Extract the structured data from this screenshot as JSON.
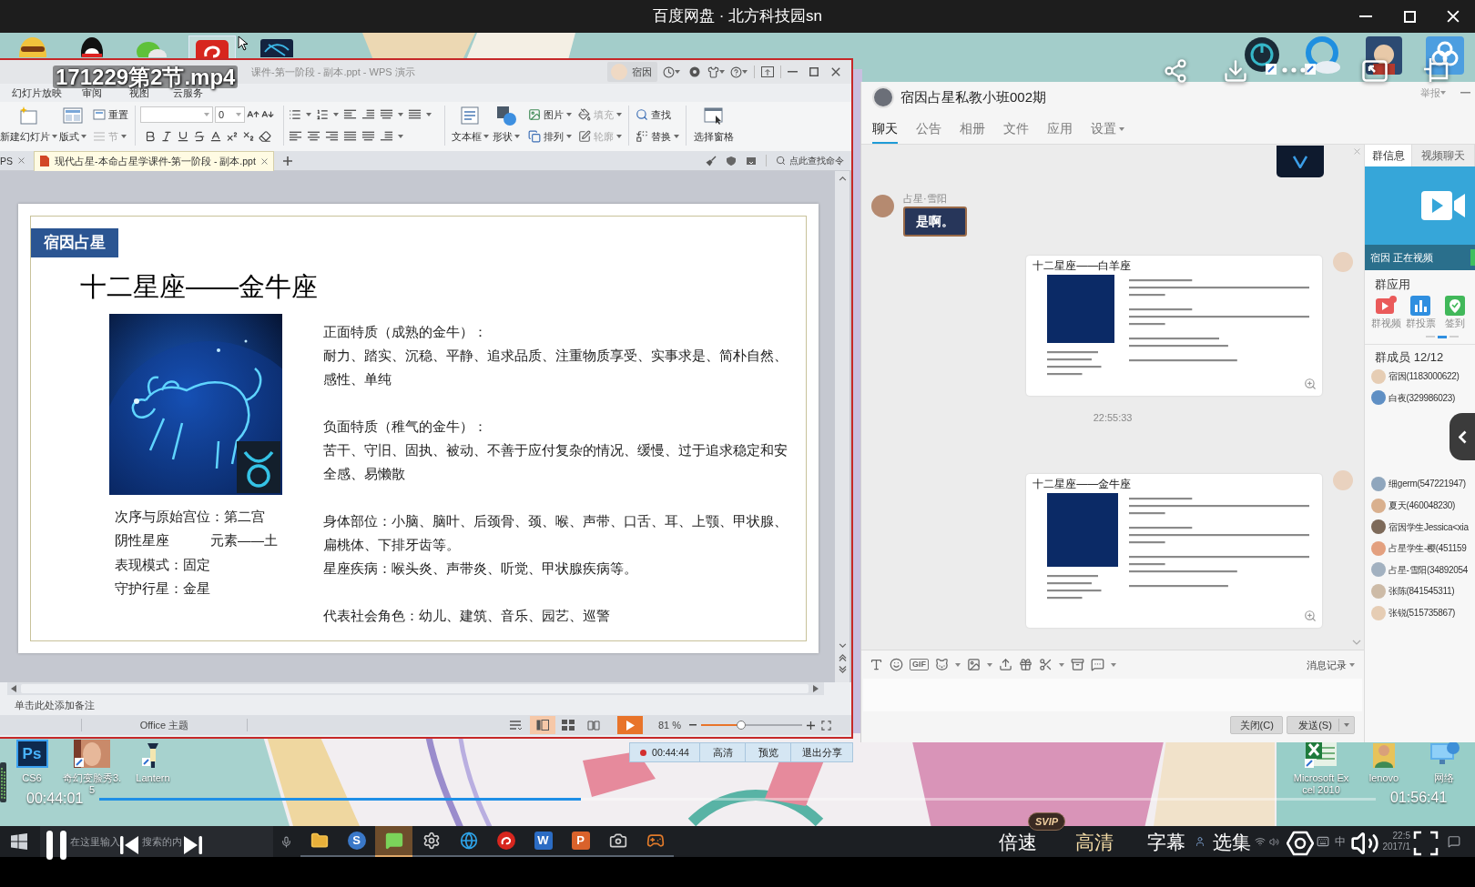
{
  "player": {
    "title": "百度网盘 · 北方科技园sn",
    "file_name": "171229第2节.mp4",
    "playing": true,
    "elapsed": "00:44:01",
    "duration": "01:56:41",
    "level": 0.377,
    "controls": [
      {
        "kind": "speed",
        "label": "倍速",
        "badge": "SVIP",
        "highlighted": false
      },
      {
        "kind": "quality",
        "label": "高清",
        "highlighted": true
      },
      {
        "kind": "subtitles",
        "label": "字幕",
        "highlighted": false
      },
      {
        "kind": "episodes",
        "label": "选集",
        "highlighted": false
      }
    ]
  },
  "desktop": {
    "top_left_icons": [
      {
        "kind": "mask",
        "selected": false
      },
      {
        "kind": "penguin",
        "selected": false
      },
      {
        "kind": "chat",
        "selected": false
      },
      {
        "kind": "music",
        "selected": true
      },
      {
        "kind": "star",
        "selected": false
      }
    ],
    "top_right_icons": [
      {
        "kind": "power"
      },
      {
        "kind": "cloud"
      },
      {
        "kind": "cartoon"
      },
      {
        "kind": "cloud-logo"
      }
    ],
    "bottom_left_icons": [
      {
        "kind": "photoshop",
        "glyph": "Ps",
        "label": "CS6"
      },
      {
        "kind": "photo-app",
        "label": "奇幻变脸秀3.5"
      },
      {
        "kind": "lantern",
        "label": "Lantern"
      }
    ],
    "bottom_right_icons": [
      {
        "kind": "excel",
        "label": "Microsoft Excel 2010"
      },
      {
        "kind": "user",
        "label": "lenovo"
      },
      {
        "kind": "network",
        "label": "网络"
      }
    ]
  },
  "wps": {
    "title": "课件-第一阶段 - 副本.ppt - WPS 演示",
    "user": "宿因",
    "menu": [
      "幻灯片放映",
      "审阅",
      "视图",
      "云服务"
    ],
    "ribbon": {
      "new_slide": {
        "label": "新建幻灯片",
        "disabled": false
      },
      "layout": {
        "label": "版式",
        "disabled": false
      },
      "reset": {
        "label": "重置",
        "disabled": false
      },
      "section": {
        "label": "节",
        "disabled": true
      },
      "font_size": "0",
      "text_box": {
        "label": "文本框",
        "disabled": false
      },
      "shape": {
        "label": "形状",
        "disabled": false
      },
      "picture": {
        "label": "图片",
        "disabled": false
      },
      "fill": {
        "label": "填充",
        "disabled": true
      },
      "arrange": {
        "label": "排列",
        "disabled": false
      },
      "outline": {
        "label": "轮廓",
        "disabled": true
      },
      "find": {
        "label": "查找",
        "disabled": false
      },
      "replace": {
        "label": "替换",
        "disabled": false
      },
      "selection_pane": {
        "label": "选择窗格",
        "disabled": false
      }
    },
    "tabs": [
      {
        "label": "PS",
        "selected": false
      },
      {
        "label": "现代占星-本命占星学课件-第一阶段 - 副本.ppt",
        "selected": true
      }
    ],
    "command_search": "点此查找命令",
    "slide": {
      "tag": "宿因占星",
      "title": "十二星座——金牛座",
      "facts": [
        [
          "次序与原始宫位：第二宫"
        ],
        [
          "阴性星座",
          "元素——土"
        ],
        [
          "表现模式：固定"
        ],
        [
          "守护行星：金星"
        ]
      ],
      "sections": [
        [
          "正面特质（成熟的金牛）：",
          "耐力、踏实、沉稳、平静、追求品质、注重物质享受、实事求是、简朴自然、感性、单纯"
        ],
        [
          "负面特质（稚气的金牛）：",
          "苦干、守旧、固执、被动、不善于应付复杂的情况、缓慢、过于追求稳定和安全感、易懒散"
        ],
        [
          "身体部位：小脑、脑叶、后颈骨、颈、喉、声带、口舌、耳、上颚、甲状腺、扁桃体、下排牙齿等。",
          "星座疾病：喉头炎、声带炎、听觉、甲状腺疾病等。"
        ],
        [
          "代表社会角色：幼儿、建筑、音乐、园艺、巡警"
        ]
      ]
    },
    "notes": "单击此处添加备注",
    "theme": "Office 主题",
    "views": [
      {
        "kind": "normal",
        "selected": true
      },
      {
        "kind": "sorter",
        "selected": false
      },
      {
        "kind": "reading",
        "selected": false
      }
    ],
    "zoom": "81 %",
    "zoom_slider": {
      "level": 0.4
    }
  },
  "share_bar": {
    "recording": true,
    "time": "00:44:44",
    "buttons": [
      "高清",
      "预览",
      "退出分享"
    ]
  },
  "qq": {
    "group_name": "宿因占星私教小班002期",
    "report": "举报",
    "tabs": [
      {
        "label": "聊天",
        "selected": true,
        "dropdown": false
      },
      {
        "label": "公告",
        "selected": false,
        "dropdown": false
      },
      {
        "label": "相册",
        "selected": false,
        "dropdown": false
      },
      {
        "label": "文件",
        "selected": false,
        "dropdown": false
      },
      {
        "label": "应用",
        "selected": false,
        "dropdown": false
      },
      {
        "label": "设置",
        "selected": false,
        "dropdown": true
      }
    ],
    "messages": [
      {
        "kind": "image"
      },
      {
        "kind": "text",
        "sender": "占星·雪阳",
        "text": "是啊。"
      },
      {
        "kind": "slide",
        "title": "十二星座——白羊座"
      },
      {
        "kind": "time",
        "text": "22:55:33"
      },
      {
        "kind": "slide",
        "title": "十二星座——金牛座"
      }
    ],
    "toolbar_gif": "GIF",
    "history": "消息记录",
    "buttons": [
      {
        "label": "关闭(C)",
        "split": false
      },
      {
        "label": "发送(S)",
        "split": true
      }
    ],
    "side_tabs": [
      {
        "label": "群信息",
        "selected": true
      },
      {
        "label": "视频聊天",
        "selected": false
      }
    ],
    "video_status": "宿因 正在视频",
    "apps_title": "群应用",
    "apps": [
      {
        "kind": "video",
        "label": "群视频"
      },
      {
        "kind": "vote",
        "label": "群投票"
      },
      {
        "kind": "checkin",
        "label": "签到"
      }
    ],
    "members_title": "群成员 12/12",
    "member_groups": [
      [
        "宿因(1183000622)",
        "白夜(329986023)"
      ],
      [
        "细germ(547221947)",
        "夏天(460048230)",
        "宿因学生Jessica<xia",
        "占星学生-樱(451159",
        "占星-雪阳(34892054",
        "张陈(841545311)",
        "张锐(515735867)"
      ]
    ]
  },
  "taskbar": {
    "search_parts": [
      "在这里输入",
      "搜索的内"
    ],
    "apps": [
      {
        "kind": "folder",
        "active": false
      },
      {
        "kind": "sogou",
        "glyph": "S",
        "active": false
      },
      {
        "kind": "wechat",
        "active": true
      },
      {
        "kind": "settings",
        "active": false
      },
      {
        "kind": "browser",
        "active": false
      },
      {
        "kind": "music",
        "active": false
      },
      {
        "kind": "writer",
        "glyph": "W",
        "active": false
      },
      {
        "kind": "presentation",
        "glyph": "P",
        "active": false
      },
      {
        "kind": "camera",
        "active": false
      },
      {
        "kind": "game",
        "active": false
      }
    ],
    "ime": "中",
    "time": "22:5",
    "date": "2017/1"
  }
}
